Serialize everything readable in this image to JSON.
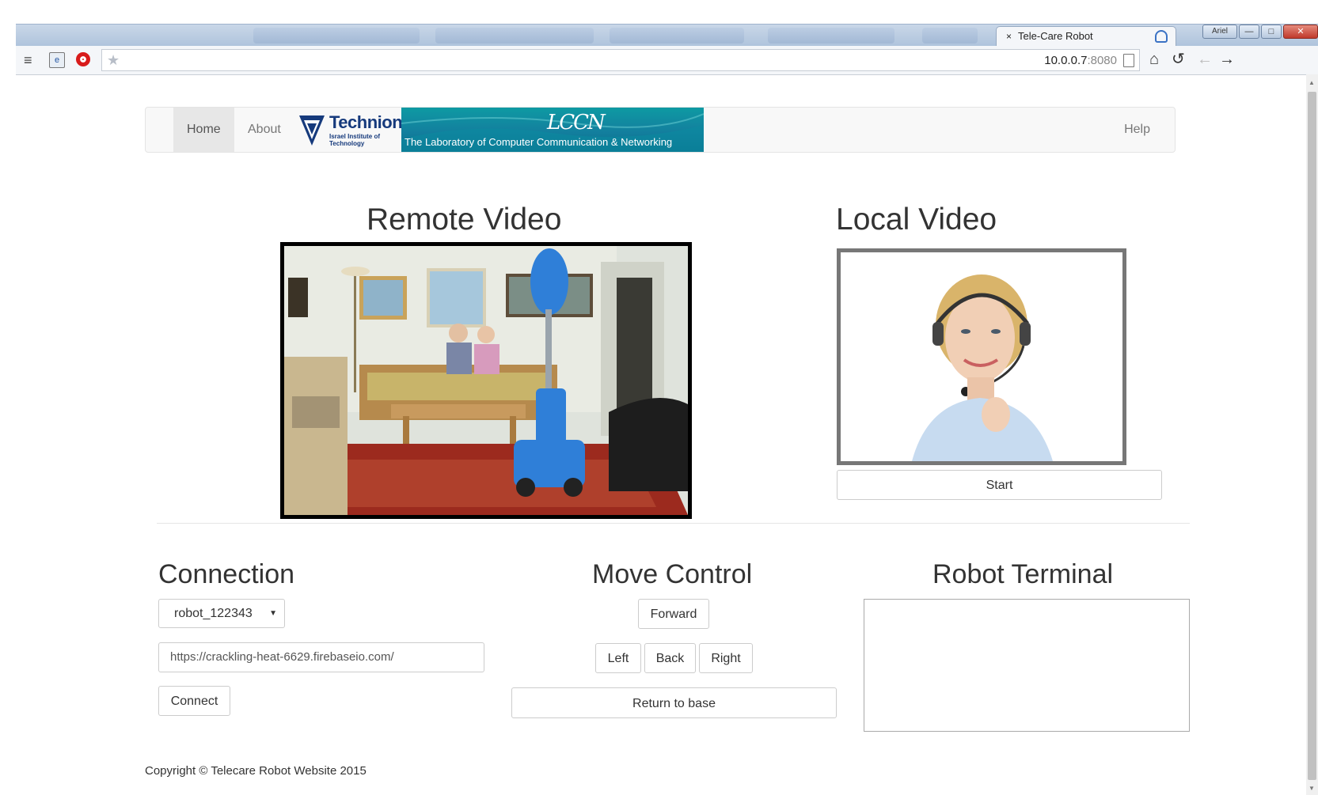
{
  "browser": {
    "active_tab": {
      "title": "Tele-Care Robot",
      "close_glyph": "×",
      "icon": "extension-icon"
    },
    "window_buttons": {
      "user": "Ariel",
      "minimize": "—",
      "maximize": "□",
      "close": "✕"
    },
    "toolbar": {
      "menu_icon": "menu-icon",
      "ext_icon": "ext-icon",
      "opera_icon": "opera-icon",
      "star_icon": "bookmark-star-icon"
    },
    "url": {
      "host": "10.0.0.7",
      "port": ":8080"
    },
    "nav": {
      "home": "home-icon",
      "reload": "reload-icon",
      "back": "back-icon",
      "forward": "forward-icon"
    }
  },
  "navbar": {
    "home": "Home",
    "about": "About",
    "help": "Help",
    "technion": {
      "name": "Technion",
      "sub_line1": "Israel Institute of",
      "sub_line2": "Technology"
    },
    "lccn": {
      "mark": "LCCN",
      "text": "The Laboratory of Computer Communication & Networking"
    }
  },
  "video": {
    "remote_title": "Remote Video",
    "local_title": "Local Video",
    "start_button": "Start"
  },
  "connection": {
    "title": "Connection",
    "robot_select": "robot_122343",
    "url_value": "https://crackling-heat-6629.firebaseio.com/",
    "connect_button": "Connect"
  },
  "move_control": {
    "title": "Move Control",
    "forward": "Forward",
    "left": "Left",
    "back": "Back",
    "right": "Right",
    "return_to_base": "Return to base"
  },
  "terminal": {
    "title": "Robot Terminal"
  },
  "footer": {
    "copyright": "Copyright © Telecare Robot Website 2015"
  },
  "colors": {
    "navbar_bg": "#f8f8f8",
    "technion_blue": "#163a7c",
    "lccn_teal": "#0e9aa3",
    "robot_blue": "#2f7fd8"
  }
}
